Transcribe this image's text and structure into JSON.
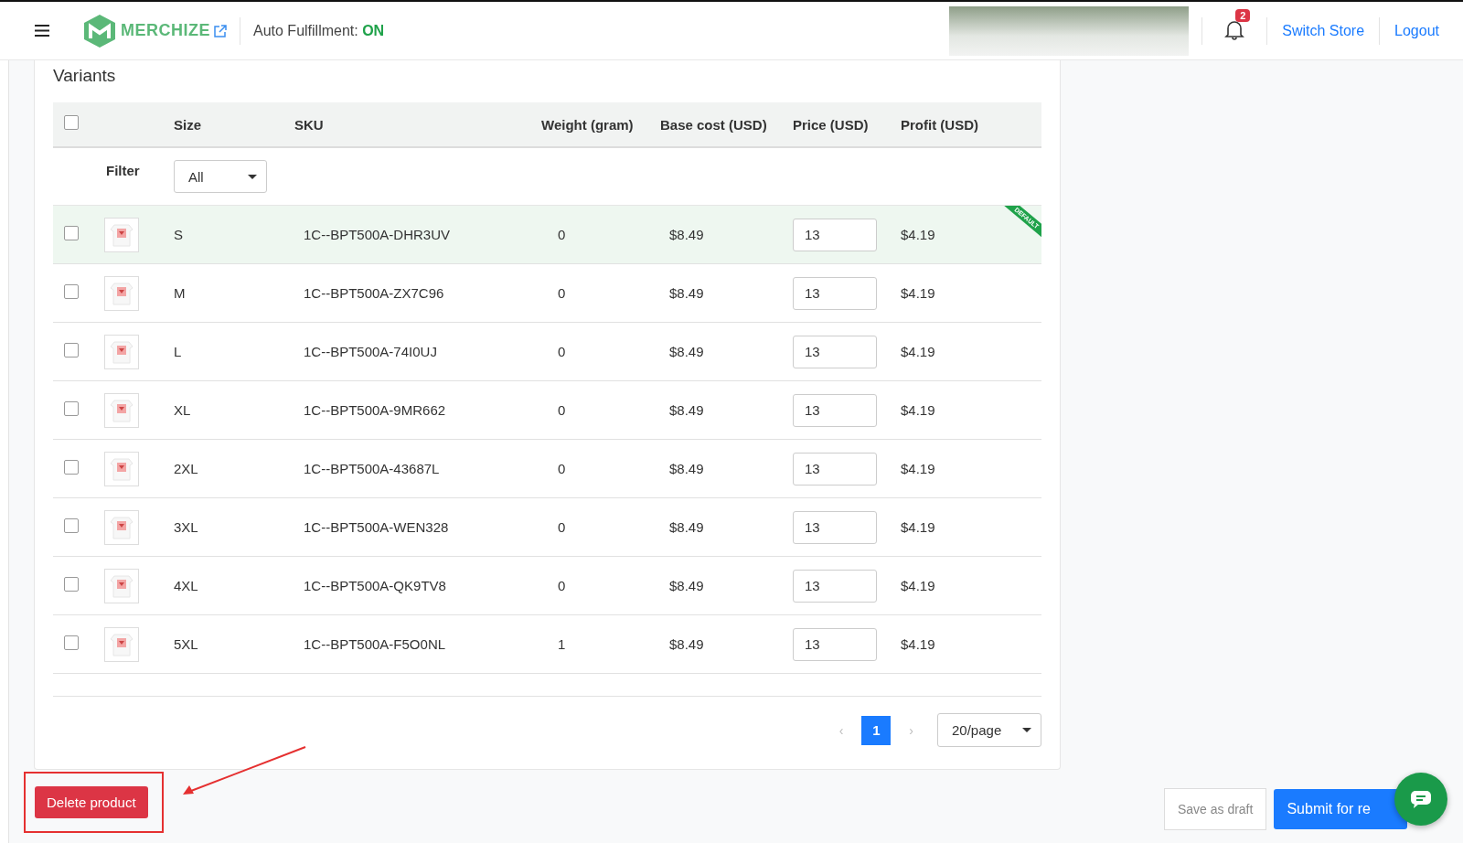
{
  "header": {
    "brand": "MERCHIZE",
    "auto_fulfillment_label": "Auto Fulfillment:",
    "auto_fulfillment_value": "ON",
    "notification_count": "2",
    "links": [
      "Switch Store",
      "Logout"
    ]
  },
  "variants": {
    "title": "Variants",
    "all_selected": false,
    "columns": [
      "Size",
      "SKU",
      "Weight (gram)",
      "Base cost (USD)",
      "Price (USD)",
      "Profit (USD)"
    ],
    "filter": {
      "label": "Filter",
      "value": "All"
    },
    "rows": [
      {
        "selected": false,
        "size": "S",
        "sku": "1C--BPT500A-DHR3UV",
        "weight": "0",
        "base_cost": "$8.49",
        "price": "13",
        "profit": "$4.19",
        "badge": "DEFAULT"
      },
      {
        "selected": false,
        "size": "M",
        "sku": "1C--BPT500A-ZX7C96",
        "weight": "0",
        "base_cost": "$8.49",
        "price": "13",
        "profit": "$4.19"
      },
      {
        "selected": false,
        "size": "L",
        "sku": "1C--BPT500A-74I0UJ",
        "weight": "0",
        "base_cost": "$8.49",
        "price": "13",
        "profit": "$4.19"
      },
      {
        "selected": false,
        "size": "XL",
        "sku": "1C--BPT500A-9MR662",
        "weight": "0",
        "base_cost": "$8.49",
        "price": "13",
        "profit": "$4.19"
      },
      {
        "selected": false,
        "size": "2XL",
        "sku": "1C--BPT500A-43687L",
        "weight": "0",
        "base_cost": "$8.49",
        "price": "13",
        "profit": "$4.19"
      },
      {
        "selected": false,
        "size": "3XL",
        "sku": "1C--BPT500A-WEN328",
        "weight": "0",
        "base_cost": "$8.49",
        "price": "13",
        "profit": "$4.19"
      },
      {
        "selected": false,
        "size": "4XL",
        "sku": "1C--BPT500A-QK9TV8",
        "weight": "0",
        "base_cost": "$8.49",
        "price": "13",
        "profit": "$4.19"
      },
      {
        "selected": false,
        "size": "5XL",
        "sku": "1C--BPT500A-F5O0NL",
        "weight": "1",
        "base_cost": "$8.49",
        "price": "13",
        "profit": "$4.19"
      }
    ],
    "pagination": {
      "prev": "‹",
      "pages": [
        {
          "label": "1",
          "selected": true
        }
      ],
      "next": "›",
      "page_size": "20/page"
    }
  },
  "footer": {
    "delete": "Delete product",
    "save_draft": "Save as draft",
    "submit": "Submit for re"
  }
}
